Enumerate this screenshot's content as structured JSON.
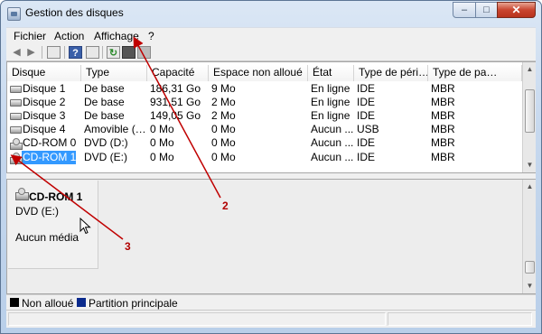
{
  "window": {
    "title": "Gestion des disques"
  },
  "menu": [
    "Fichier",
    "Action",
    "Affichage",
    "?"
  ],
  "table": {
    "headers": [
      "Disque",
      "Type",
      "Capacité",
      "Espace non alloué",
      "État",
      "Type de péri…",
      "Type de pa…"
    ],
    "rows": [
      {
        "icon": "disk-icon",
        "cells": [
          "Disque 1",
          "De base",
          "186,31 Go",
          "9 Mo",
          "En ligne",
          "IDE",
          "MBR"
        ]
      },
      {
        "icon": "disk-icon",
        "cells": [
          "Disque 2",
          "De base",
          "931,51 Go",
          "2 Mo",
          "En ligne",
          "IDE",
          "MBR"
        ]
      },
      {
        "icon": "disk-icon",
        "cells": [
          "Disque 3",
          "De base",
          "149,05 Go",
          "2 Mo",
          "En ligne",
          "IDE",
          "MBR"
        ]
      },
      {
        "icon": "disk-icon",
        "cells": [
          "Disque 4",
          "Amovible (…",
          "0 Mo",
          "0 Mo",
          "Aucun ...",
          "USB",
          "MBR"
        ]
      },
      {
        "icon": "cdrom-icon",
        "cells": [
          "CD-ROM 0",
          "DVD (D:)",
          "0 Mo",
          "0 Mo",
          "Aucun ...",
          "IDE",
          "MBR"
        ]
      },
      {
        "icon": "cdrom-icon",
        "cells": [
          "CD-ROM 1",
          "DVD (E:)",
          "0 Mo",
          "0 Mo",
          "Aucun ...",
          "IDE",
          "MBR"
        ],
        "selected": true
      }
    ]
  },
  "detail": {
    "name": "CD-ROM 1",
    "type": "DVD (E:)",
    "media": "Aucun média"
  },
  "legend": [
    {
      "label": "Non alloué",
      "color": "#000000"
    },
    {
      "label": "Partition principale",
      "color": "#0a2a8c"
    }
  ],
  "annotations": [
    "2",
    "3"
  ],
  "colors": {
    "selection": "#3399ff",
    "annotation": "#c00000"
  }
}
